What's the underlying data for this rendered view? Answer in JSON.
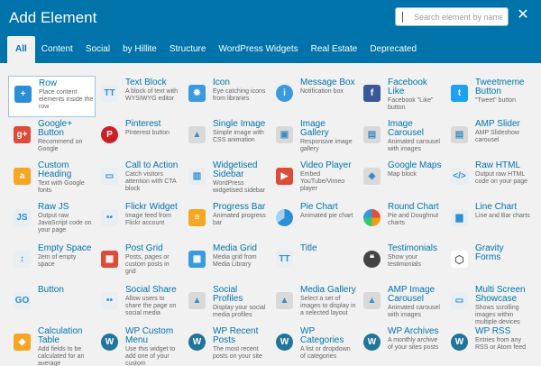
{
  "header": {
    "title": "Add Element",
    "search_placeholder": "Search element by name",
    "close_glyph": "✕"
  },
  "tabs": [
    {
      "label": "All",
      "active": true
    },
    {
      "label": "Content"
    },
    {
      "label": "Social"
    },
    {
      "label": "by Hillite"
    },
    {
      "label": "Structure"
    },
    {
      "label": "WordPress Widgets"
    },
    {
      "label": "Real Estate"
    },
    {
      "label": "Deprecated"
    }
  ],
  "elements": [
    {
      "key": "row",
      "name": "Row",
      "desc": "Place content elements inside the row",
      "icon": "plus-icon",
      "glyph": "+",
      "cls": "c-blue",
      "selected": true
    },
    {
      "key": "text-block",
      "name": "Text Block",
      "desc": "A block of text with WYSIWYG editor",
      "icon": "text-icon",
      "glyph": "TT",
      "cls": "c-light"
    },
    {
      "key": "icon",
      "name": "Icon",
      "desc": "Eye catching icons from libraries",
      "icon": "star-icon",
      "glyph": "✹",
      "cls": "c-blue2"
    },
    {
      "key": "message-box",
      "name": "Message Box",
      "desc": "Notification box",
      "icon": "info-icon",
      "glyph": "i",
      "cls": "c-blue2 round"
    },
    {
      "key": "facebook-like",
      "name": "Facebook Like",
      "desc": "Facebook \"Like\" button",
      "icon": "facebook-icon",
      "glyph": "f",
      "cls": "c-fb"
    },
    {
      "key": "tweetmeme",
      "name": "Tweetmeme Button",
      "desc": "\"Tweet\" button",
      "icon": "twitter-icon",
      "glyph": "t",
      "cls": "c-tw"
    },
    {
      "key": "google-plus",
      "name": "Google+ Button",
      "desc": "Recommend on Google",
      "icon": "google-plus-icon",
      "glyph": "g+",
      "cls": "c-red"
    },
    {
      "key": "pinterest",
      "name": "Pinterest",
      "desc": "Pinterest button",
      "icon": "pinterest-icon",
      "glyph": "P",
      "cls": "c-pin round"
    },
    {
      "key": "single-image",
      "name": "Single Image",
      "desc": "Simple image with CSS animation",
      "icon": "image-icon",
      "glyph": "▲",
      "cls": "c-grey"
    },
    {
      "key": "image-gallery",
      "name": "Image Gallery",
      "desc": "Responsive image gallery",
      "icon": "gallery-icon",
      "glyph": "▣",
      "cls": "c-grey"
    },
    {
      "key": "image-carousel",
      "name": "Image Carousel",
      "desc": "Animated carousel with images",
      "icon": "carousel-icon",
      "glyph": "▤",
      "cls": "c-grey"
    },
    {
      "key": "amp-slider",
      "name": "AMP Slider",
      "desc": "AMP Slideshow carousel",
      "icon": "slider-icon",
      "glyph": "▤",
      "cls": "c-grey"
    },
    {
      "key": "custom-heading",
      "name": "Custom Heading",
      "desc": "Text with Google fonts",
      "icon": "heading-icon",
      "glyph": "a",
      "cls": "c-orange"
    },
    {
      "key": "call-to-action",
      "name": "Call to Action",
      "desc": "Catch visitors attention with CTA block",
      "icon": "cta-icon",
      "glyph": "▭",
      "cls": "c-light"
    },
    {
      "key": "widgetised-sidebar",
      "name": "Widgetised Sidebar",
      "desc": "WordPress widgetised sidebar",
      "icon": "sidebar-icon",
      "glyph": "▥",
      "cls": "c-light"
    },
    {
      "key": "video-player",
      "name": "Video Player",
      "desc": "Embed YouTube/Vimeo player",
      "icon": "video-icon",
      "glyph": "▶",
      "cls": "c-red"
    },
    {
      "key": "google-maps",
      "name": "Google Maps",
      "desc": "Map block",
      "icon": "map-icon",
      "glyph": "◆",
      "cls": "c-grey"
    },
    {
      "key": "raw-html",
      "name": "Raw HTML",
      "desc": "Output raw HTML code on your page",
      "icon": "html-icon",
      "glyph": "</>",
      "cls": "c-light"
    },
    {
      "key": "raw-js",
      "name": "Raw JS",
      "desc": "Output raw JavaScript code on your page",
      "icon": "js-icon",
      "glyph": "JS",
      "cls": "c-light"
    },
    {
      "key": "flickr-widget",
      "name": "Flickr Widget",
      "desc": "Image feed from Flickr account",
      "icon": "flickr-icon",
      "glyph": "••",
      "cls": "c-light"
    },
    {
      "key": "progress-bar",
      "name": "Progress Bar",
      "desc": "Animated progress bar",
      "icon": "progress-bar-icon",
      "glyph": "≡",
      "cls": "c-orange"
    },
    {
      "key": "pie-chart",
      "name": "Pie Chart",
      "desc": "Animated pie chart",
      "icon": "pie-chart-icon",
      "glyph": "",
      "cls": "c-pie round"
    },
    {
      "key": "round-chart",
      "name": "Round Chart",
      "desc": "Pie and Doughnut charts",
      "icon": "round-chart-icon",
      "glyph": "",
      "cls": "c-ring round"
    },
    {
      "key": "line-chart",
      "name": "Line Chart",
      "desc": "Line and Bar charts",
      "icon": "line-chart-icon",
      "glyph": "▆",
      "cls": "c-light"
    },
    {
      "key": "empty-space",
      "name": "Empty Space",
      "desc": "2em of empty space",
      "icon": "empty-space-icon",
      "glyph": "↕",
      "cls": "c-light"
    },
    {
      "key": "post-grid",
      "name": "Post Grid",
      "desc": "Posts, pages or custom posts in grid",
      "icon": "post-grid-icon",
      "glyph": "▦",
      "cls": "c-red"
    },
    {
      "key": "media-grid",
      "name": "Media Grid",
      "desc": "Media grid from Media Library",
      "icon": "media-grid-icon",
      "glyph": "▦",
      "cls": "c-blue2"
    },
    {
      "key": "title",
      "name": "Title",
      "desc": "",
      "icon": "title-icon",
      "glyph": "TT",
      "cls": "c-light"
    },
    {
      "key": "testimonials",
      "name": "Testimonials",
      "desc": "Show your testimonials",
      "icon": "testimonials-icon",
      "glyph": "❝",
      "cls": "c-dark round"
    },
    {
      "key": "gravity-forms",
      "name": "Gravity Forms",
      "desc": "",
      "icon": "gravity-forms-icon",
      "glyph": "⬡",
      "cls": "c-gf"
    },
    {
      "key": "button",
      "name": "Button",
      "desc": "",
      "icon": "go-button-icon",
      "glyph": "GO",
      "cls": "c-light"
    },
    {
      "key": "social-share",
      "name": "Social Share",
      "desc": "Allow users to share the page on social media",
      "icon": "share-icon",
      "glyph": "••",
      "cls": "c-light"
    },
    {
      "key": "social-profiles",
      "name": "Social Profiles",
      "desc": "Display your social media profiles",
      "icon": "profiles-icon",
      "glyph": "▲",
      "cls": "c-grey"
    },
    {
      "key": "media-gallery",
      "name": "Media Gallery",
      "desc": "Select a set of images to display in a selected layout",
      "icon": "media-gallery-icon",
      "glyph": "▲",
      "cls": "c-grey"
    },
    {
      "key": "amp-image-carousel",
      "name": "AMP Image Carousel",
      "desc": "Animated carousel with images",
      "icon": "amp-carousel-icon",
      "glyph": "▲",
      "cls": "c-grey"
    },
    {
      "key": "multi-screen-showcase",
      "name": "Multi Screen Showcase",
      "desc": "Shows scrolling images within multiple devices",
      "icon": "devices-icon",
      "glyph": "▭",
      "cls": "c-light"
    },
    {
      "key": "calculation-table",
      "name": "Calculation Table",
      "desc": "Add fields to be calculated for an average",
      "icon": "calculation-icon",
      "glyph": "◆",
      "cls": "c-orange"
    },
    {
      "key": "wp-custom-menu",
      "name": "WP Custom Menu",
      "desc": "Use this widget to add one of your custom",
      "icon": "wordpress-icon",
      "glyph": "W",
      "cls": "c-wp round"
    },
    {
      "key": "wp-recent-posts",
      "name": "WP Recent Posts",
      "desc": "The most recent posts on your site",
      "icon": "wordpress-icon",
      "glyph": "W",
      "cls": "c-wp round"
    },
    {
      "key": "wp-categories",
      "name": "WP Categories",
      "desc": "A list or dropdown of categories",
      "icon": "wordpress-icon",
      "glyph": "W",
      "cls": "c-wp round"
    },
    {
      "key": "wp-archives",
      "name": "WP Archives",
      "desc": "A monthly archive of your sites posts",
      "icon": "wordpress-icon",
      "glyph": "W",
      "cls": "c-wp round"
    },
    {
      "key": "wp-rss",
      "name": "WP RSS",
      "desc": "Entries from any RSS or Atom feed",
      "icon": "wordpress-icon",
      "glyph": "W",
      "cls": "c-wp round"
    }
  ]
}
